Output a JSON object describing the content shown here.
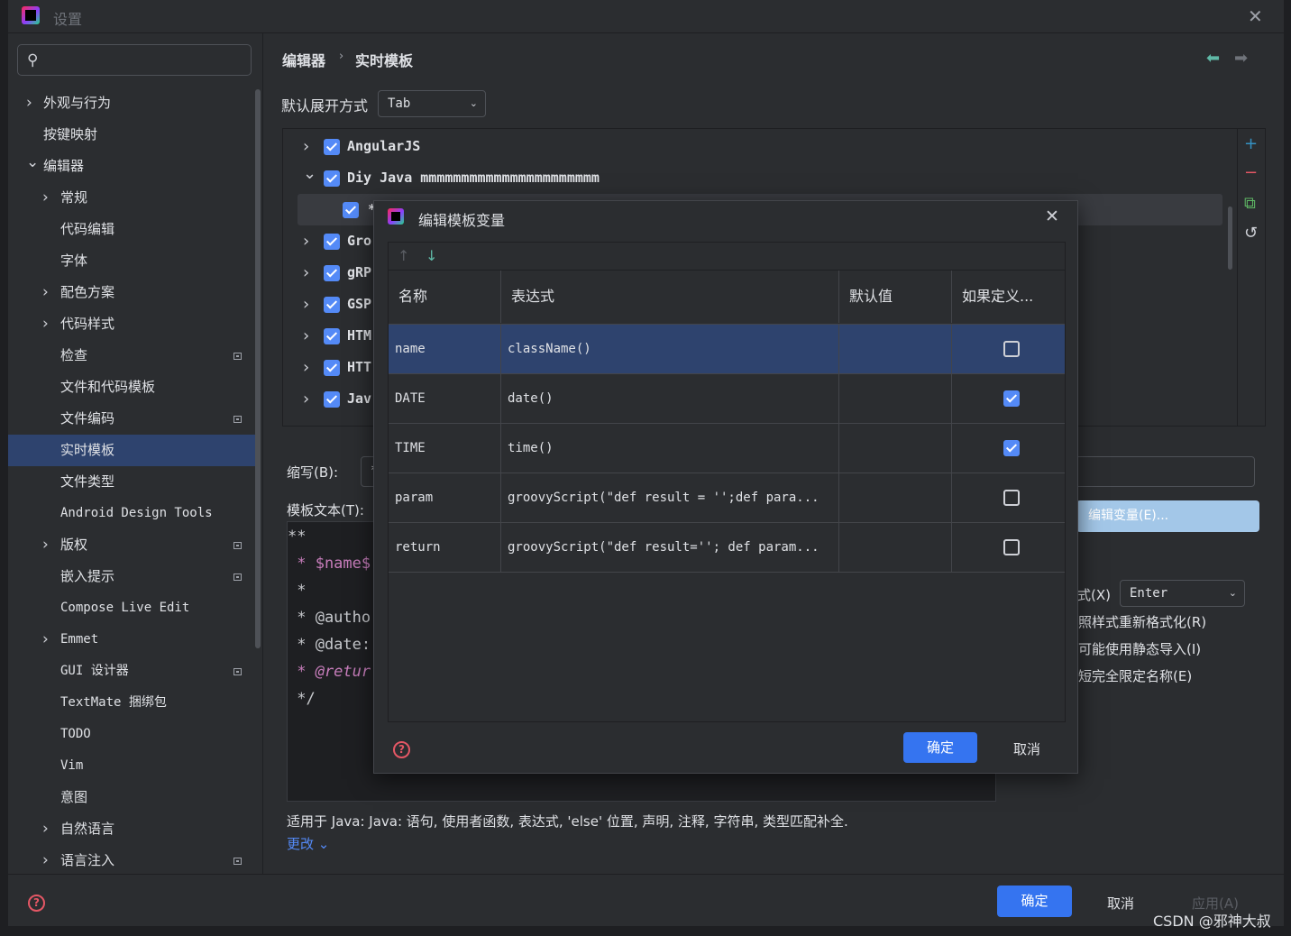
{
  "window": {
    "title": "设置"
  },
  "search": {
    "placeholder": ""
  },
  "sidebar": {
    "items": [
      {
        "label": "外观与行为",
        "chevron": "right",
        "level": 0,
        "badge": false
      },
      {
        "label": "按键映射",
        "chevron": "",
        "level": 0,
        "badge": false
      },
      {
        "label": "编辑器",
        "chevron": "down",
        "level": 0,
        "badge": false
      },
      {
        "label": "常规",
        "chevron": "right",
        "level": 1,
        "badge": false
      },
      {
        "label": "代码编辑",
        "chevron": "",
        "level": 1,
        "badge": false
      },
      {
        "label": "字体",
        "chevron": "",
        "level": 1,
        "badge": false
      },
      {
        "label": "配色方案",
        "chevron": "right",
        "level": 1,
        "badge": false
      },
      {
        "label": "代码样式",
        "chevron": "right",
        "level": 1,
        "badge": false
      },
      {
        "label": "检查",
        "chevron": "",
        "level": 1,
        "badge": true
      },
      {
        "label": "文件和代码模板",
        "chevron": "",
        "level": 1,
        "badge": false
      },
      {
        "label": "文件编码",
        "chevron": "",
        "level": 1,
        "badge": true
      },
      {
        "label": "实时模板",
        "chevron": "",
        "level": 1,
        "badge": false,
        "selected": true
      },
      {
        "label": "文件类型",
        "chevron": "",
        "level": 1,
        "badge": false
      },
      {
        "label": "Android Design Tools",
        "chevron": "",
        "level": 1,
        "badge": false
      },
      {
        "label": "版权",
        "chevron": "right",
        "level": 1,
        "badge": true
      },
      {
        "label": "嵌入提示",
        "chevron": "",
        "level": 1,
        "badge": true
      },
      {
        "label": "Compose Live Edit",
        "chevron": "",
        "level": 1,
        "badge": false
      },
      {
        "label": "Emmet",
        "chevron": "right",
        "level": 1,
        "badge": false
      },
      {
        "label": "GUI 设计器",
        "chevron": "",
        "level": 1,
        "badge": true
      },
      {
        "label": "TextMate 捆绑包",
        "chevron": "",
        "level": 1,
        "badge": false
      },
      {
        "label": "TODO",
        "chevron": "",
        "level": 1,
        "badge": false
      },
      {
        "label": "Vim",
        "chevron": "",
        "level": 1,
        "badge": false
      },
      {
        "label": "意图",
        "chevron": "",
        "level": 1,
        "badge": false
      },
      {
        "label": "自然语言",
        "chevron": "right",
        "level": 1,
        "badge": false
      },
      {
        "label": "语言注入",
        "chevron": "right",
        "level": 1,
        "badge": true
      }
    ]
  },
  "breadcrumb": {
    "a": "编辑器",
    "sep": "›",
    "b": "实时模板"
  },
  "expand": {
    "label": "默认展开方式",
    "value": "Tab"
  },
  "template_groups": [
    {
      "label": "AngularJS",
      "chevron": "›",
      "checked": true
    },
    {
      "label": "Diy Java mmmmmmmmmmmmmmmmmmmmmm",
      "chevron": "⌄",
      "checked": true
    },
    {
      "label": "*",
      "chevron": "",
      "checked": true,
      "child": true
    },
    {
      "label": "Gro",
      "chevron": "›",
      "checked": true
    },
    {
      "label": "gRP",
      "chevron": "›",
      "checked": true
    },
    {
      "label": "GSP",
      "chevron": "›",
      "checked": true
    },
    {
      "label": "HTM",
      "chevron": "›",
      "checked": true
    },
    {
      "label": "HTT",
      "chevron": "›",
      "checked": true
    },
    {
      "label": "Jav",
      "chevron": "›",
      "checked": true
    }
  ],
  "abbr": {
    "label": "缩写(B):",
    "value": "*"
  },
  "template_text": {
    "label": "模板文本(T):",
    "lines": [
      "**",
      " * $name$",
      " *",
      " * @autho",
      " * @date:",
      " * @retur",
      " */"
    ]
  },
  "edit_vars_button": "编辑变量(E)...",
  "options": {
    "expand_label": "式(X)",
    "expand_value": "Enter",
    "reformat": "照样式重新格式化(R)",
    "static_import": "可能使用静态导入(I)",
    "shorten_fq": "短完全限定名称(E)"
  },
  "applies_to": "适用于 Java: Java: 语句, 使用者函数, 表达式, 'else' 位置, 声明, 注释, 字符串, 类型匹配补全.",
  "more_link": "更改 ⌄",
  "bottom": {
    "ok": "确定",
    "cancel": "取消",
    "apply": "应用(A)"
  },
  "watermark": "CSDN @邪神大叔",
  "modal": {
    "title": "编辑模板变量",
    "columns": [
      "名称",
      "表达式",
      "默认值",
      "如果定义..."
    ],
    "rows": [
      {
        "name": "name",
        "expression": "className()",
        "default": "",
        "skip": false,
        "selected": true
      },
      {
        "name": "DATE",
        "expression": "date()",
        "default": "",
        "skip": true
      },
      {
        "name": "TIME",
        "expression": "time()",
        "default": "",
        "skip": true
      },
      {
        "name": "param",
        "expression": "groovyScript(\"def result = '';def para...",
        "default": "",
        "skip": false
      },
      {
        "name": "return",
        "expression": "groovyScript(\"def result=''; def param...",
        "default": "",
        "skip": false
      }
    ],
    "ok": "确定",
    "cancel": "取消"
  },
  "colors": {
    "accent": "#3574f0",
    "selection": "#2e436e",
    "checkbox": "#548af7",
    "background": "#2b2d30",
    "danger": "#e55765"
  }
}
